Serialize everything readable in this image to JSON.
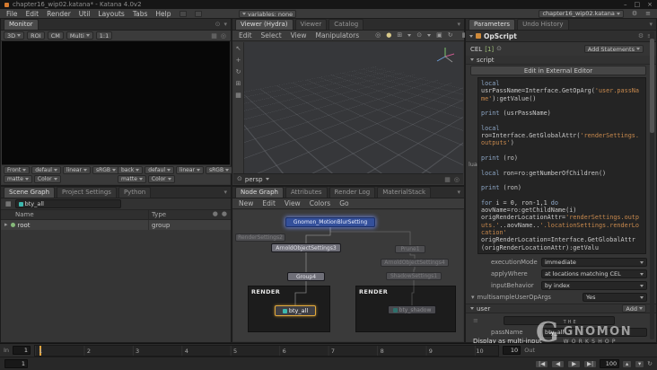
{
  "icons": {
    "minimize": "–",
    "maximize": "□",
    "close": "×",
    "gear": "⚙",
    "menu": "≡",
    "grid": "▦",
    "target": "◎",
    "dot": "●",
    "camera": "▣",
    "rotate": "↻",
    "select": "↖",
    "boxplus": "⊞",
    "eye": "⊙",
    "tri_down": "▾",
    "tri_right": "▸",
    "tri_up": "▴",
    "plus": "+",
    "step_back": "|◀",
    "frame_back": "◀",
    "play": "▶",
    "step_fwd": "▶|"
  },
  "window": {
    "title": "chapter16_wip02.katana* - Katana 4.0v2"
  },
  "menubar": {
    "items": [
      "File",
      "Edit",
      "Render",
      "Util",
      "Layouts",
      "Tabs",
      "Help"
    ],
    "variables": "variables: none",
    "scene_file": "chapter16_wip02.katana"
  },
  "monitor": {
    "tab": "Monitor",
    "toolbar": [
      "3D",
      "ROI",
      "CM",
      "Multi",
      "1:1"
    ],
    "front": {
      "buffer": "Front",
      "opt1": "defaul",
      "opt2": "linear",
      "opt3": "sRGB",
      "row2a": "matte",
      "row2b": "Color"
    },
    "back": {
      "buffer": "back",
      "opt1": "defaul",
      "opt2": "linear",
      "opt3": "sRGB",
      "row2a": "matte",
      "row2b": "Color"
    }
  },
  "scenegraph": {
    "tabs": [
      "Scene Graph",
      "Project Settings",
      "Python"
    ],
    "filter": "bty_all",
    "columns": {
      "name": "Name",
      "type": "Type"
    },
    "root": {
      "name": "root",
      "type": "group"
    }
  },
  "viewer": {
    "tabs": [
      "Viewer (Hydra)",
      "Viewer",
      "Catalog"
    ],
    "menus": [
      "Edit",
      "Select",
      "View",
      "Manipulators"
    ],
    "camera": "persp"
  },
  "nodegraph": {
    "tabs": [
      "Node Graph",
      "Attributes",
      "Render Log",
      "MaterialStack"
    ],
    "menus": [
      "New",
      "Edit",
      "View",
      "Colors",
      "Go"
    ],
    "nodes": {
      "motionblur": "Gnomon_MotionBlurSetting",
      "rendersettings": "RenderSettings2",
      "arnold3": "ArnoldObjectSettings3",
      "prune": "Prune1",
      "arnold4": "ArnoldObjectSettings4",
      "group4": "Group4",
      "shadow": "ShadowSettings1",
      "bty_all": "bty_all",
      "bty_shadow": "bty_shadow"
    },
    "backdrops": {
      "left": "RENDER",
      "right": "RENDER"
    }
  },
  "parameters": {
    "tabs": [
      "Parameters",
      "Undo History"
    ],
    "node_name": "OpScript",
    "cel": {
      "label": "CEL",
      "count": "[1]",
      "add": "Add Statements"
    },
    "script": {
      "section": "script",
      "edit_button": "Edit in External Editor",
      "language": "lua",
      "code": "local\nusrPassName=Interface.GetOpArg('user.passName'):getValue()\n\nprint (usrPassName)\n\nlocal\nro=Interface.GetGlobalAttr('renderSettings.outputs')\n\nprint (ro)\n\nlocal ron=ro:getNumberOfChildren()\n\nprint (ron)\n\nfor i = 0, ron-1,1 do\naovName=ro:getChildName(i)\norigRenderLocationAttr='renderSettings.outputs.'..aovName..'.locationSettings.renderLocation'\norigRenderLocation=Interface.GetGlobalAttr(origRenderLocationAttr):getValu"
    },
    "fields": {
      "executionMode": {
        "label": "executionMode",
        "value": "immediate"
      },
      "applyWhere": {
        "label": "applyWhere",
        "value": "at locations matching CEL"
      },
      "inputBehavior": {
        "label": "inputBehavior",
        "value": "by index"
      },
      "multisample": {
        "label": "multisampleUserOpArgs",
        "value": "Yes"
      }
    },
    "user": {
      "section": "user",
      "add": "Add",
      "passName_label": "passName",
      "passName_value": "bty_all"
    },
    "hint": "Display as multi-input"
  },
  "timeline": {
    "in_label": "In",
    "in_value": "1",
    "out_label": "Out",
    "out_value": "10",
    "ticks": [
      "1",
      "2",
      "3",
      "4",
      "5",
      "6",
      "7",
      "8",
      "9",
      "10"
    ],
    "current": "1",
    "speed": "100"
  },
  "watermark": {
    "the": "THE",
    "gnomon": "GNOMON",
    "workshop": "WORKSHOP",
    "g": "G"
  },
  "colors": {
    "accent_orange": "#e2a93c",
    "node_blue": "#34509b",
    "teal": "#3db8ae"
  }
}
